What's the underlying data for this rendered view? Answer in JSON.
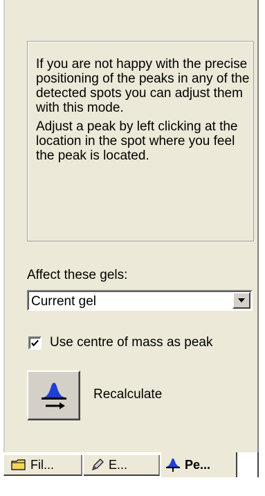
{
  "info": {
    "paragraph1": "If you are not happy with the precise positioning of the peaks in any of the detected spots you can adjust them with this mode.",
    "paragraph2": "Adjust a peak by left clicking at the location in the spot where you feel the peak is located."
  },
  "affect": {
    "label": "Affect these gels:",
    "selected": "Current gel"
  },
  "centre_of_mass": {
    "label": "Use centre of mass as peak",
    "checked": true
  },
  "recalculate": {
    "label": "Recalculate",
    "icon": "peak-arrow-icon"
  },
  "tabs": [
    {
      "label": "Fil...",
      "icon": "folder-icon"
    },
    {
      "label": "E...",
      "icon": "pencil-icon"
    },
    {
      "label": "Pe...",
      "icon": "peak-icon",
      "active": true
    }
  ],
  "colors": {
    "panel_bg": "#ece9d8",
    "peak_blue": "#1f3fd6"
  }
}
